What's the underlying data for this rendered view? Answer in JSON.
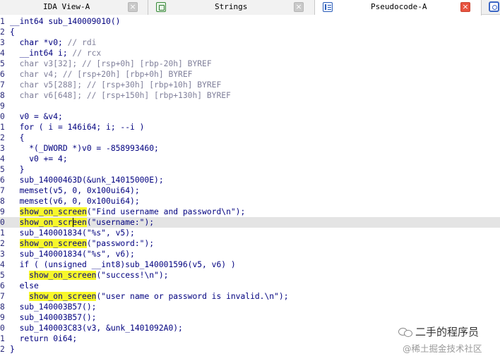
{
  "tabs": [
    {
      "label": "IDA View-A",
      "icon": "ida-view-icon",
      "close": "×",
      "active": false
    },
    {
      "label": "Strings",
      "icon": "strings-icon",
      "close": "×",
      "active": false
    },
    {
      "label": "Pseudocode-A",
      "icon": "pseudocode-icon",
      "close": "×",
      "active": true
    }
  ],
  "extra_tab_icon": "hex-view-icon",
  "highlight_color": "#f7f72a",
  "code_lines": [
    {
      "n": "1",
      "segments": [
        {
          "t": "__int64 sub_140009010()"
        }
      ]
    },
    {
      "n": "2",
      "segments": [
        {
          "t": "{"
        }
      ]
    },
    {
      "n": "3",
      "segments": [
        {
          "t": "  char *v0; "
        },
        {
          "t": "// rdi",
          "k": "c"
        }
      ]
    },
    {
      "n": "4",
      "segments": [
        {
          "t": "  __int64 i; "
        },
        {
          "t": "// rcx",
          "k": "c"
        }
      ]
    },
    {
      "n": "5",
      "segments": [
        {
          "t": "  char v3[32]; // [rsp+0h] [rbp-20h] BYREF",
          "k": "c"
        }
      ]
    },
    {
      "n": "6",
      "segments": [
        {
          "t": "  char v4; // [rsp+20h] [rbp+0h] BYREF",
          "k": "c"
        }
      ]
    },
    {
      "n": "7",
      "segments": [
        {
          "t": "  char v5[288]; // [rsp+30h] [rbp+10h] BYREF",
          "k": "c"
        }
      ]
    },
    {
      "n": "8",
      "segments": [
        {
          "t": "  char v6[648]; // [rsp+150h] [rbp+130h] BYREF",
          "k": "c"
        }
      ]
    },
    {
      "n": "9",
      "segments": [
        {
          "t": ""
        }
      ]
    },
    {
      "n": "0",
      "segments": [
        {
          "t": "  v0 = &v4;"
        }
      ]
    },
    {
      "n": "1",
      "segments": [
        {
          "t": "  for ( i = 146i64; i; --i )"
        }
      ]
    },
    {
      "n": "2",
      "segments": [
        {
          "t": "  {"
        }
      ]
    },
    {
      "n": "3",
      "segments": [
        {
          "t": "    *(_DWORD *)v0 = -858993460;"
        }
      ]
    },
    {
      "n": "4",
      "segments": [
        {
          "t": "    v0 += 4;"
        }
      ]
    },
    {
      "n": "5",
      "segments": [
        {
          "t": "  }"
        }
      ]
    },
    {
      "n": "6",
      "segments": [
        {
          "t": "  sub_14000463D(&unk_14015000E);"
        }
      ]
    },
    {
      "n": "7",
      "segments": [
        {
          "t": "  memset(v5, 0, 0x100ui64);"
        }
      ]
    },
    {
      "n": "8",
      "segments": [
        {
          "t": "  memset(v6, 0, 0x100ui64);"
        }
      ]
    },
    {
      "n": "9",
      "segments": [
        {
          "t": "  "
        },
        {
          "t": "show_on_screen",
          "k": "hl"
        },
        {
          "t": "(\"Find username and password\\n\");"
        }
      ]
    },
    {
      "n": "0",
      "current": true,
      "segments": [
        {
          "t": "  "
        },
        {
          "t": "show_on_screen",
          "k": "hl"
        },
        {
          "t": "(\"username:\");"
        }
      ]
    },
    {
      "n": "1",
      "segments": [
        {
          "t": "  sub_140001834(\"%s\", v5);"
        }
      ]
    },
    {
      "n": "2",
      "segments": [
        {
          "t": "  "
        },
        {
          "t": "show_on_screen",
          "k": "hl"
        },
        {
          "t": "(\"password:\");"
        }
      ]
    },
    {
      "n": "3",
      "segments": [
        {
          "t": "  sub_140001834(\"%s\", v6);"
        }
      ]
    },
    {
      "n": "4",
      "segments": [
        {
          "t": "  if ( (unsigned __int8)sub_140001596(v5, v6) )"
        }
      ]
    },
    {
      "n": "5",
      "segments": [
        {
          "t": "    "
        },
        {
          "t": "show_on_screen",
          "k": "hl"
        },
        {
          "t": "(\"success!\\n\");"
        }
      ]
    },
    {
      "n": "6",
      "segments": [
        {
          "t": "  else"
        }
      ]
    },
    {
      "n": "7",
      "segments": [
        {
          "t": "    "
        },
        {
          "t": "show_on_screen",
          "k": "hl"
        },
        {
          "t": "(\"user name or password is invalid.\\n\");"
        }
      ]
    },
    {
      "n": "8",
      "segments": [
        {
          "t": "  sub_140003B57();"
        }
      ]
    },
    {
      "n": "9",
      "segments": [
        {
          "t": "  sub_140003B57();"
        }
      ]
    },
    {
      "n": "0",
      "segments": [
        {
          "t": "  sub_140003C83(v3, &unk_1401092A0);"
        }
      ]
    },
    {
      "n": "1",
      "segments": [
        {
          "t": "  return 0i64;"
        }
      ]
    },
    {
      "n": "2",
      "segments": [
        {
          "t": "}"
        }
      ]
    }
  ],
  "watermark": {
    "title": "二手的程序员",
    "subtitle": "@稀土掘金技术社区",
    "icon": "wechat-icon"
  }
}
